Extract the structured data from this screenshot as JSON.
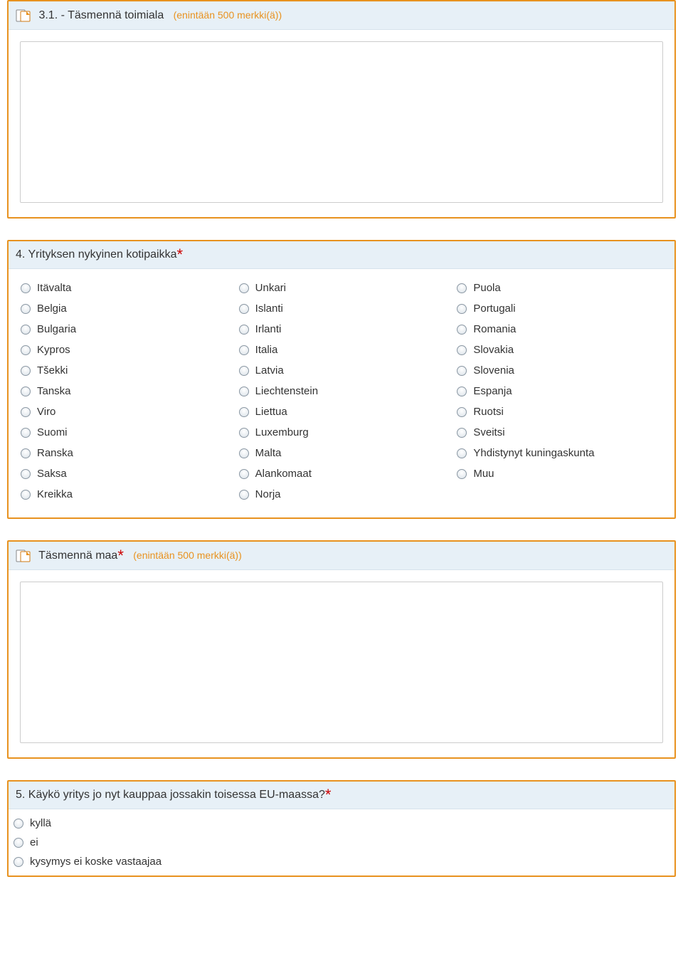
{
  "q31": {
    "title": "3.1. - Täsmennä toimiala",
    "hint": "(enintään 500 merkki(ä))"
  },
  "q4": {
    "title": "4. Yrityksen nykyinen kotipaikka",
    "columns": [
      [
        "Itävalta",
        "Belgia",
        "Bulgaria",
        "Kypros",
        "Tšekki",
        "Tanska",
        "Viro",
        "Suomi",
        "Ranska",
        "Saksa",
        "Kreikka"
      ],
      [
        "Unkari",
        "Islanti",
        "Irlanti",
        "Italia",
        "Latvia",
        "Liechtenstein",
        "Liettua",
        "Luxemburg",
        "Malta",
        "Alankomaat",
        "Norja"
      ],
      [
        "Puola",
        "Portugali",
        "Romania",
        "Slovakia",
        "Slovenia",
        "Espanja",
        "Ruotsi",
        "Sveitsi",
        "Yhdistynyt kuningaskunta",
        "Muu"
      ]
    ]
  },
  "qcountry": {
    "title": "Täsmennä maa",
    "hint": "(enintään 500 merkki(ä))"
  },
  "q5": {
    "title": "5. Käykö yritys jo nyt kauppaa jossakin toisessa EU-maassa?",
    "options": [
      "kyllä",
      "ei",
      "kysymys ei koske vastaajaa"
    ]
  },
  "required_mark": "*"
}
